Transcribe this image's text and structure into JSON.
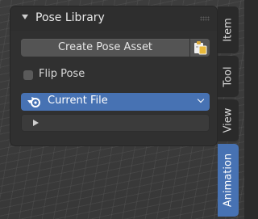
{
  "panel": {
    "title": "Pose Library",
    "create_button": "Create Pose Asset",
    "paste_icon": "clipboard-paste-icon",
    "flip_pose": {
      "label": "Flip Pose",
      "checked": false
    },
    "library_dropdown": {
      "selected": "Current File",
      "icon": "blender-logo-icon"
    }
  },
  "tabs": [
    {
      "label": "Item",
      "active": false
    },
    {
      "label": "Tool",
      "active": false
    },
    {
      "label": "View",
      "active": false
    },
    {
      "label": "Animation",
      "active": true
    }
  ],
  "colors": {
    "accent": "#4772b3",
    "panel_bg": "#303030",
    "button_bg": "#545454",
    "text": "#e6e6e6"
  }
}
